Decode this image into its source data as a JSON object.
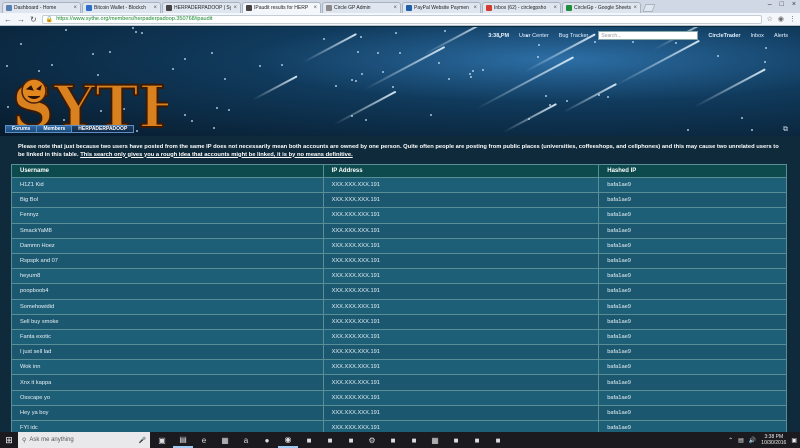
{
  "browser": {
    "tabs": [
      {
        "title": "Dashboard - Home",
        "color": "#5a7fb0",
        "active": false
      },
      {
        "title": "Bitcoin Wallet - Blockch",
        "color": "#2a6fc9",
        "active": false
      },
      {
        "title": "HERPADERPADOOP | Syt",
        "color": "#444444",
        "active": false
      },
      {
        "title": "IPaudit results for HERP",
        "color": "#444444",
        "active": true
      },
      {
        "title": "Circle GP Admin",
        "color": "#8a8a8a",
        "active": false
      },
      {
        "title": "PayPal Website Paymen",
        "color": "#1f5fa8",
        "active": false
      },
      {
        "title": "Inbox (62) - circlegpsho",
        "color": "#d23b2f",
        "active": false
      },
      {
        "title": "CircleGp - Google Sheets",
        "color": "#1e8e3e",
        "active": false
      }
    ],
    "url": "https://www.sythe.org/members/herpaderpadoop.350768/ipaudit"
  },
  "header": {
    "time": "3:38 PM",
    "links": [
      "User Center",
      "Bug Tracker"
    ],
    "search_placeholder": "Search...",
    "username": "CircleTrader",
    "inbox": "Inbox",
    "alerts": "Alerts",
    "logo_text": "SYTHE"
  },
  "breadcrumb": [
    "Forums",
    "Members",
    "HERPADERPADOOP"
  ],
  "notice": {
    "text": "Please note that just because two users have posted from the same IP does not necessarily mean both accounts are owned by one person. Quite often people are posting from public places (universities, coffeeshops, and cellphones) and this may cause two unrelated users to be linked in this table.",
    "underlined": "This search only gives you a rough idea that accounts might be linked, it is by no means definitive."
  },
  "table": {
    "headers": [
      "Username",
      "IP Address",
      "Hashed IP"
    ],
    "rows": [
      [
        "H1Z1 Kid",
        "XXX.XXX.XXX.191",
        "bafa1ae9"
      ],
      [
        "Big Bol",
        "XXX.XXX.XXX.191",
        "bafa1ae9"
      ],
      [
        "Fennyz",
        "XXX.XXX.XXX.191",
        "bafa1ae9"
      ],
      [
        "SmackYaM8",
        "XXX.XXX.XXX.191",
        "bafa1ae9"
      ],
      [
        "Dammn Hoez",
        "XXX.XXX.XXX.191",
        "bafa1ae9"
      ],
      [
        "Rspspk and 07",
        "XXX.XXX.XXX.191",
        "bafa1ae9"
      ],
      [
        "heyum8",
        "XXX.XXX.XXX.191",
        "bafa1ae9"
      ],
      [
        "poopboob4",
        "XXX.XXX.XXX.191",
        "bafa1ae9"
      ],
      [
        "Somehowidid",
        "XXX.XXX.XXX.191",
        "bafa1ae9"
      ],
      [
        "Sell buy smoke",
        "XXX.XXX.XXX.191",
        "bafa1ae9"
      ],
      [
        "Fanta exotic",
        "XXX.XXX.XXX.191",
        "bafa1ae9"
      ],
      [
        "I just sell lad",
        "XXX.XXX.XXX.191",
        "bafa1ae9"
      ],
      [
        "Wok inn",
        "XXX.XXX.XXX.191",
        "bafa1ae9"
      ],
      [
        "Xnx it kappa",
        "XXX.XXX.XXX.191",
        "bafa1ae9"
      ],
      [
        "Osscape yo",
        "XXX.XXX.XXX.191",
        "bafa1ae9"
      ],
      [
        "Hey ya boy",
        "XXX.XXX.XXX.191",
        "bafa1ae9"
      ],
      [
        "FYI idc",
        "XXX.XXX.XXX.191",
        "bafa1ae9"
      ]
    ]
  },
  "taskbar": {
    "search_placeholder": "Ask me anything",
    "time": "3:38 PM",
    "date": "10/30/2016",
    "icons": [
      "task-view-icon",
      "folder-icon",
      "edge-icon",
      "store-icon",
      "amazon-icon",
      "firefox-icon",
      "chrome-icon",
      "app-icon",
      "app-icon-2",
      "app-icon-3",
      "steam-icon",
      "app-icon-4",
      "app-icon-5",
      "calculator-icon",
      "app-icon-6",
      "app-icon-7",
      "app-icon-8"
    ]
  }
}
